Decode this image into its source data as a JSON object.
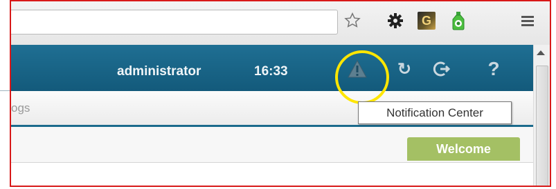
{
  "toolbar": {
    "icons": [
      "star-icon",
      "gear-icon",
      "g-extension-icon",
      "bottle-extension-icon",
      "menu-icon"
    ],
    "g_extension_letter": "G"
  },
  "header": {
    "username": "administrator",
    "time": "16:33",
    "icons": [
      "warning-icon",
      "refresh-icon",
      "logout-icon",
      "help-icon"
    ],
    "help_glyph": "?",
    "refresh_glyph": "↻"
  },
  "menu": {
    "partial_item": "ogs"
  },
  "tooltip": {
    "text": "Notification Center"
  },
  "tabs": {
    "active": "Welcome"
  },
  "colors": {
    "header": "#1b6a8c",
    "tab_green": "#a4c064",
    "highlight": "#ffe600",
    "frame": "#d81818"
  }
}
